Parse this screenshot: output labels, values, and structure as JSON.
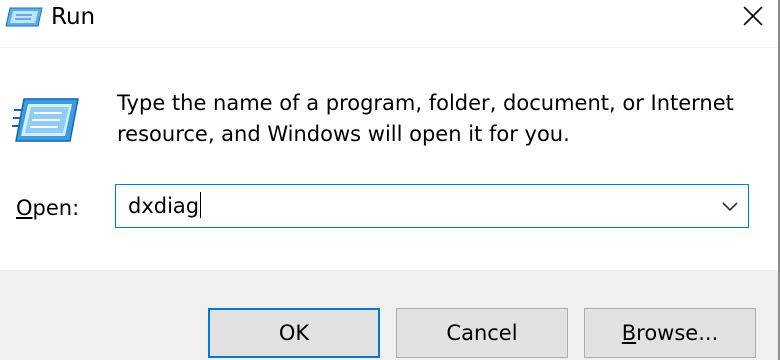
{
  "window": {
    "title": "Run",
    "close_icon": "close-icon",
    "app_icon": "run-icon"
  },
  "dialog": {
    "description_line1": "Type the name of a program, folder, document, or Internet",
    "description_line2": "resource, and Windows will open it for you.",
    "open_label_prefix": "O",
    "open_label_rest": "pen:",
    "open_value": "dxdiag",
    "dropdown_icon": "chevron-down-icon"
  },
  "buttons": {
    "ok": "OK",
    "cancel": "Cancel",
    "browse_prefix": "B",
    "browse_rest": "rowse..."
  },
  "colors": {
    "accent": "#0078d7",
    "footer_bg": "#f0f0f0",
    "button_bg": "#e1e1e1"
  }
}
